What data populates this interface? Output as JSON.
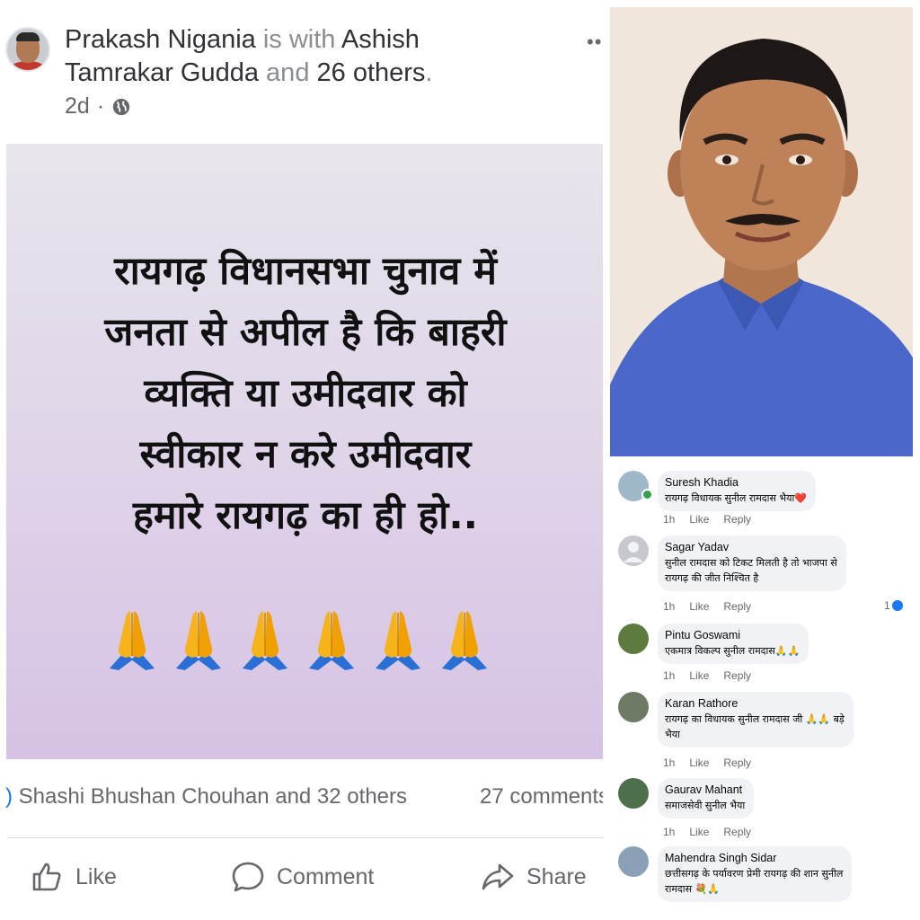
{
  "post": {
    "author": "Prakash Nigania",
    "with_text": " is with ",
    "tagged": "Ashish Tamrakar Gudda",
    "and_text": " and ",
    "others": "26 others",
    "period": ".",
    "time": "2d",
    "more": "••",
    "text_lines": [
      "रायगढ़ विधानसभा चुनाव में",
      "जनता से अपील है कि बाहरी",
      "व्यक्ति या उमीदवार को",
      "स्वीकार न करे उमीदवार",
      "हमारे रायगढ़ का ही हो.."
    ],
    "reactions_text": "Shashi Bhushan Chouhan and 32 others",
    "comments_text": "27 comments",
    "actions": {
      "like": "Like",
      "comment": "Comment",
      "share": "Share"
    }
  },
  "icons": {
    "globe": "globe-icon",
    "pray": "folded-hands-icon",
    "like": "thumbs-up-icon",
    "comment": "speech-bubble-icon",
    "share": "share-arrow-icon"
  },
  "colors": {
    "fb_grey": "#65676b",
    "bubble": "#f0f2f5",
    "card_top": "#e8e5ec",
    "card_bottom": "#d6c2e4",
    "portrait_bg": "#f1e6dc",
    "jacket": "#4a67c9",
    "like_blue": "#1877f2"
  },
  "comments": [
    {
      "name": "Suresh Khadia",
      "text": "रायगढ़ विधायक सुनील रामदास भैया❤️",
      "time": "1h",
      "like": "Like",
      "reply": "Reply"
    },
    {
      "name": "Sagar Yadav",
      "text_lines": [
        "सुनील रामदास को टिकट मिलती है तो भाजपा से",
        "रायगढ़ की जीत निश्चित है"
      ],
      "time": "1h",
      "like": "Like",
      "reply": "Reply",
      "reactions": "1"
    },
    {
      "name": "Pintu Goswami",
      "text": "एकमात्र विकल्प सुनील रामदास🙏🙏",
      "time": "1h",
      "like": "Like",
      "reply": "Reply"
    },
    {
      "name": "Karan Rathore",
      "text_lines": [
        "रायगढ़ का विधायक सुनील रामदास जी 🙏🙏 बड़े",
        "भैया"
      ],
      "time": "1h",
      "like": "Like",
      "reply": "Reply"
    },
    {
      "name": "Gaurav Mahant",
      "text": "समाजसेवी सुनील भैया",
      "time": "1h",
      "like": "Like",
      "reply": "Reply"
    },
    {
      "name": "Mahendra Singh Sidar",
      "text_lines": [
        "छत्तीसगढ़ के पर्यावरण प्रेमी रायगढ़ की शान सुनील",
        "रामदास 💐🙏"
      ]
    }
  ]
}
